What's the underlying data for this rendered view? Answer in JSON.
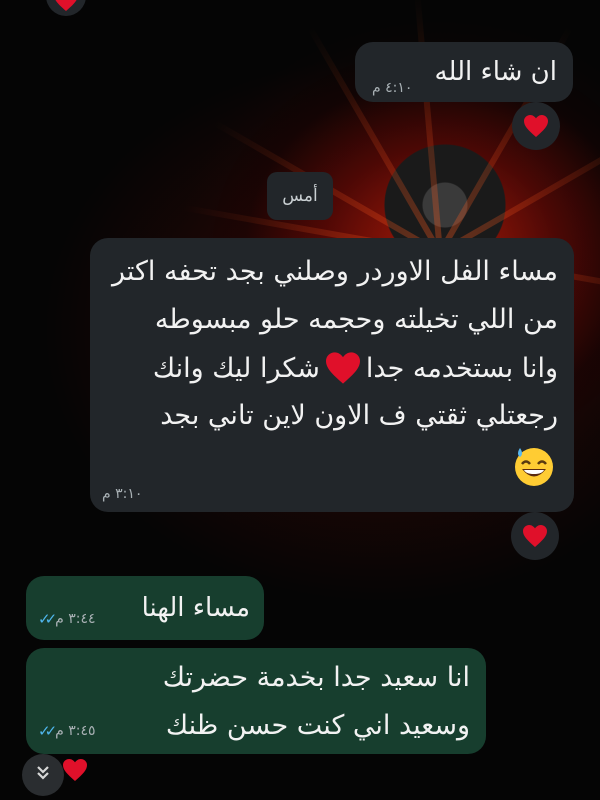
{
  "date_separator": "أمس",
  "messages": [
    {
      "id": "m1",
      "direction": "incoming",
      "text": "ان شاء الله",
      "time": "٤:١٠ م",
      "reaction": "heart"
    },
    {
      "id": "m2",
      "direction": "incoming",
      "lines": [
        "مساء الفل الاوردر وصلني بجد تحفه اكتر",
        "من اللي تخيلته وحجمه حلو مبسوطه",
        "وانا بستخدمه جدا",
        "شكرا ليك وانك",
        "رجعتلي ثقتي ف الاون لاين تاني بجد"
      ],
      "time": "٣:١٠ م",
      "reaction": "heart"
    },
    {
      "id": "m3",
      "direction": "outgoing",
      "text": "مساء الهنا",
      "time": "٣:٤٤ م",
      "status": "read"
    },
    {
      "id": "m4",
      "direction": "outgoing",
      "lines": [
        "انا سعيد جدا بخدمة حضرتك",
        "وسعيد اني كنت حسن ظنك"
      ],
      "time": "٣:٤٥ م",
      "status": "read"
    }
  ],
  "icons": {
    "reaction": "red-heart-icon",
    "emoji": "grinning-face-with-sweat-icon",
    "scroll": "double-chevron-down-icon",
    "read_receipt": "double-check-icon"
  },
  "colors": {
    "incoming_bubble": "#22262a",
    "outgoing_bubble": "#173e2e",
    "read_tick": "#4fb6ec",
    "heart": "#e0102a"
  }
}
